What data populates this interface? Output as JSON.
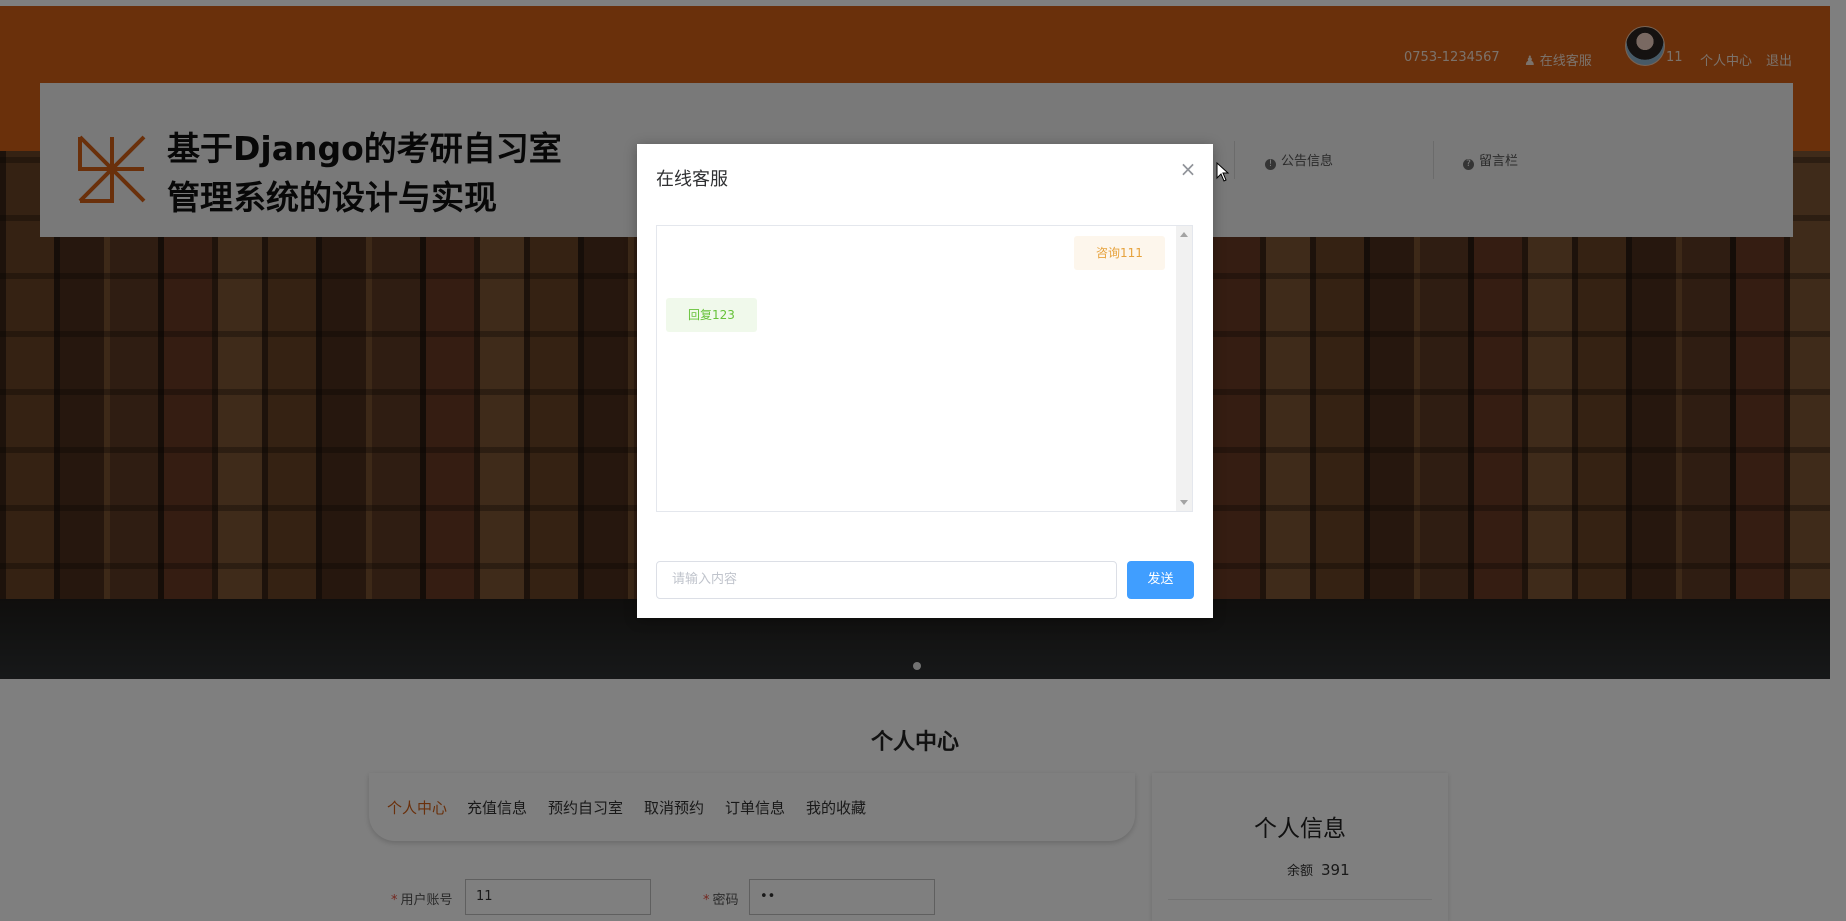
{
  "header": {
    "phone": "0753-1234567",
    "online_service_link": "在线客服",
    "username": "11",
    "personal_center_link": "个人中心",
    "logout_link": "退出",
    "site_title_line1": "基于Django的考研自习室",
    "site_title_line2": "管理系统的设计与实现",
    "nav": [
      {
        "label": "公告信息"
      },
      {
        "label": "留言栏"
      }
    ]
  },
  "page": {
    "section_title": "个人中心",
    "tabs": [
      {
        "label": "个人中心",
        "active": true
      },
      {
        "label": "充值信息"
      },
      {
        "label": "预约自习室"
      },
      {
        "label": "取消预约"
      },
      {
        "label": "订单信息"
      },
      {
        "label": "我的收藏"
      }
    ],
    "form": {
      "account_label": "用户账号",
      "account_value": "11",
      "password_label": "密码",
      "password_value": "••"
    },
    "info_card": {
      "title": "个人信息",
      "balance_label": "余额",
      "balance_value": "391"
    }
  },
  "dialog": {
    "title": "在线客服",
    "messages": [
      {
        "role": "ask",
        "text": "咨询111"
      },
      {
        "role": "reply",
        "text": "回复123"
      }
    ],
    "input_placeholder": "请输入内容",
    "send_label": "发送"
  },
  "colors": {
    "brand": "#d46017",
    "primary_button": "#409eff",
    "ask_bubble_text": "#e6a23c",
    "reply_bubble_text": "#67c23a"
  }
}
